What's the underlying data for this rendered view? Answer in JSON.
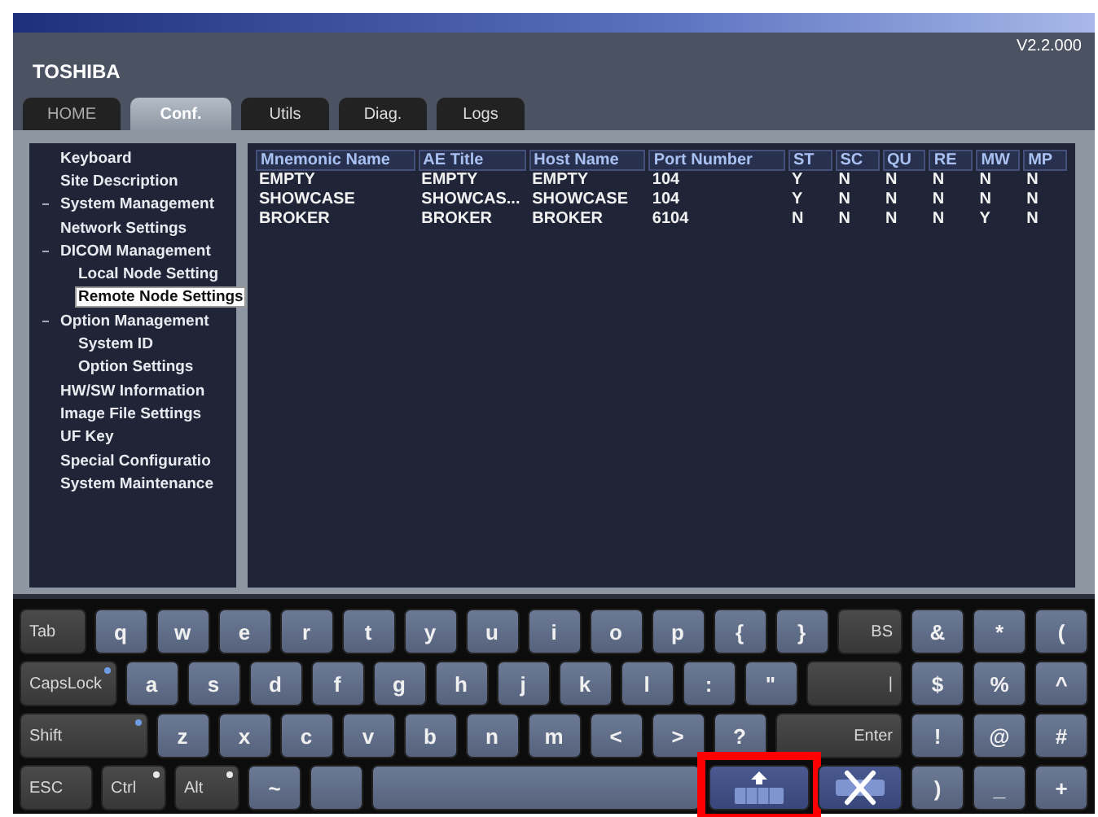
{
  "header": {
    "brand": "TOSHIBA",
    "version": "V2.2.000"
  },
  "tabs": [
    {
      "label": "HOME",
      "selected": false
    },
    {
      "label": "Conf.",
      "selected": true
    },
    {
      "label": "Utils",
      "selected": false
    },
    {
      "label": "Diag.",
      "selected": false
    },
    {
      "label": "Logs",
      "selected": false
    }
  ],
  "sidebar": {
    "items": [
      {
        "label": "Keyboard",
        "selected": false
      },
      {
        "label": "Site Description",
        "selected": false
      },
      {
        "label": "System Management",
        "selected": false,
        "expanded": true
      },
      {
        "label": "Network Settings",
        "selected": false
      },
      {
        "label": "DICOM Management",
        "selected": false,
        "expanded": true,
        "children": [
          {
            "label": "Local Node Setting",
            "selected": false
          },
          {
            "label": "Remote Node Settings",
            "selected": true
          }
        ]
      },
      {
        "label": "Option Management",
        "selected": false,
        "expanded": true,
        "children": [
          {
            "label": "System ID",
            "selected": false
          },
          {
            "label": "Option Settings",
            "selected": false
          }
        ]
      },
      {
        "label": "HW/SW Information",
        "selected": false
      },
      {
        "label": "Image File Settings",
        "selected": false
      },
      {
        "label": "UF Key",
        "selected": false
      },
      {
        "label": "Special Configuratio",
        "selected": false
      },
      {
        "label": "System Maintenance",
        "selected": false
      }
    ]
  },
  "table": {
    "columns": [
      "Mnemonic Name",
      "AE Title",
      "Host Name",
      "Port Number",
      "ST",
      "SC",
      "QU",
      "RE",
      "MW",
      "MP"
    ],
    "rows": [
      [
        "EMPTY",
        "EMPTY",
        "EMPTY",
        "104",
        "Y",
        "N",
        "N",
        "N",
        "N",
        "N"
      ],
      [
        "SHOWCASE",
        "SHOWCAS...",
        "SHOWCASE",
        "104",
        "Y",
        "N",
        "N",
        "N",
        "N",
        "N"
      ],
      [
        "BROKER",
        "BROKER",
        "BROKER",
        "6104",
        "N",
        "N",
        "N",
        "N",
        "Y",
        "N"
      ]
    ]
  },
  "keyboard": {
    "rows": [
      {
        "keys": [
          {
            "kind": "func",
            "label": "Tab"
          },
          {
            "kind": "char",
            "label": "q"
          },
          {
            "kind": "char",
            "label": "w"
          },
          {
            "kind": "char",
            "label": "e"
          },
          {
            "kind": "char",
            "label": "r"
          },
          {
            "kind": "char",
            "label": "t"
          },
          {
            "kind": "char",
            "label": "y"
          },
          {
            "kind": "char",
            "label": "u"
          },
          {
            "kind": "char",
            "label": "i"
          },
          {
            "kind": "char",
            "label": "o"
          },
          {
            "kind": "char",
            "label": "p"
          },
          {
            "kind": "char",
            "label": "{"
          },
          {
            "kind": "char",
            "label": "}"
          },
          {
            "kind": "func-end",
            "label": "BS"
          },
          {
            "kind": "char",
            "label": "&"
          },
          {
            "kind": "char",
            "label": "*"
          },
          {
            "kind": "char",
            "label": "("
          }
        ]
      },
      {
        "keys": [
          {
            "kind": "func",
            "label": "CapsLock",
            "color": "#6f9ce0"
          },
          {
            "kind": "char",
            "label": "a"
          },
          {
            "kind": "char",
            "label": "s"
          },
          {
            "kind": "char",
            "label": "d"
          },
          {
            "kind": "char",
            "label": "f"
          },
          {
            "kind": "char",
            "label": "g"
          },
          {
            "kind": "char",
            "label": "h"
          },
          {
            "kind": "char",
            "label": "j"
          },
          {
            "kind": "char",
            "label": "k"
          },
          {
            "kind": "char",
            "label": "l"
          },
          {
            "kind": "char",
            "label": ":"
          },
          {
            "kind": "char",
            "label": "\""
          },
          {
            "kind": "func-end",
            "label": "|"
          },
          {
            "kind": "char",
            "label": "$"
          },
          {
            "kind": "char",
            "label": "%"
          },
          {
            "kind": "char",
            "label": "^"
          }
        ]
      },
      {
        "keys": [
          {
            "kind": "func",
            "label": "Shift",
            "color": "#6f9ce0"
          },
          {
            "kind": "char",
            "label": "z"
          },
          {
            "kind": "char",
            "label": "x"
          },
          {
            "kind": "char",
            "label": "c"
          },
          {
            "kind": "char",
            "label": "v"
          },
          {
            "kind": "char",
            "label": "b"
          },
          {
            "kind": "char",
            "label": "n"
          },
          {
            "kind": "char",
            "label": "m"
          },
          {
            "kind": "char",
            "label": "<"
          },
          {
            "kind": "char",
            "label": ">"
          },
          {
            "kind": "char",
            "label": "?"
          },
          {
            "kind": "func-end",
            "label": "Enter"
          },
          {
            "kind": "char",
            "label": "!"
          },
          {
            "kind": "char",
            "label": "@"
          },
          {
            "kind": "char",
            "label": "#"
          }
        ]
      },
      {
        "keys": [
          {
            "kind": "func",
            "label": "ESC"
          },
          {
            "kind": "func",
            "label": "Ctrl",
            "color": "#e8e8e8"
          },
          {
            "kind": "func",
            "label": "Alt",
            "color": "#e8e8e8"
          },
          {
            "kind": "char",
            "label": "~"
          },
          {
            "kind": "char"
          },
          {
            "kind": "space"
          },
          {
            "kind": "hide",
            "highlighted": true
          },
          {
            "kind": "close"
          },
          {
            "kind": "char",
            "label": ")"
          },
          {
            "kind": "char",
            "label": "_"
          },
          {
            "kind": "char",
            "label": "+"
          }
        ]
      }
    ]
  }
}
